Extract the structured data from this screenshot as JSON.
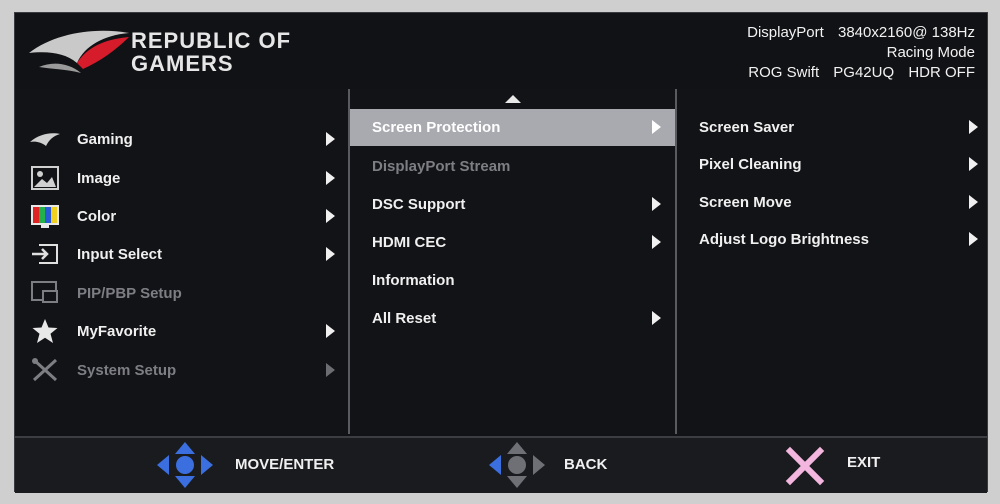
{
  "header": {
    "brand_line1": "REPUBLIC OF",
    "brand_line2": "GAMERS",
    "input": "DisplayPort",
    "resolution": "3840x2160@ 138Hz",
    "mode": "Racing Mode",
    "model_name": "ROG Swift",
    "model_code": "PG42UQ",
    "hdr": "HDR OFF"
  },
  "main_menu": [
    {
      "label": "Gaming",
      "icon": "rog-eye-icon",
      "enabled": true
    },
    {
      "label": "Image",
      "icon": "image-icon",
      "enabled": true
    },
    {
      "label": "Color",
      "icon": "color-bars-icon",
      "enabled": true
    },
    {
      "label": "Input Select",
      "icon": "input-icon",
      "enabled": true
    },
    {
      "label": "PIP/PBP Setup",
      "icon": "pip-icon",
      "enabled": false
    },
    {
      "label": "MyFavorite",
      "icon": "star-icon",
      "enabled": true
    },
    {
      "label": "System Setup",
      "icon": "tools-icon",
      "enabled": false
    }
  ],
  "submenu": [
    {
      "label": "Screen Protection",
      "selected": true,
      "enabled": true,
      "has_arrow": true
    },
    {
      "label": "DisplayPort Stream",
      "selected": false,
      "enabled": false,
      "has_arrow": false
    },
    {
      "label": "DSC Support",
      "selected": false,
      "enabled": true,
      "has_arrow": true
    },
    {
      "label": "HDMI CEC",
      "selected": false,
      "enabled": true,
      "has_arrow": true
    },
    {
      "label": "Information",
      "selected": false,
      "enabled": true,
      "has_arrow": false
    },
    {
      "label": "All Reset",
      "selected": false,
      "enabled": true,
      "has_arrow": true
    }
  ],
  "options": [
    {
      "label": "Screen Saver"
    },
    {
      "label": "Pixel Cleaning"
    },
    {
      "label": "Screen Move"
    },
    {
      "label": "Adjust Logo Brightness"
    }
  ],
  "footer": {
    "move_enter": "MOVE/ENTER",
    "back": "BACK",
    "exit": "EXIT"
  },
  "colors": {
    "accent_blue": "#3b6fe0",
    "exit_pink": "#f3b6de",
    "selection": "#a8aab0"
  }
}
